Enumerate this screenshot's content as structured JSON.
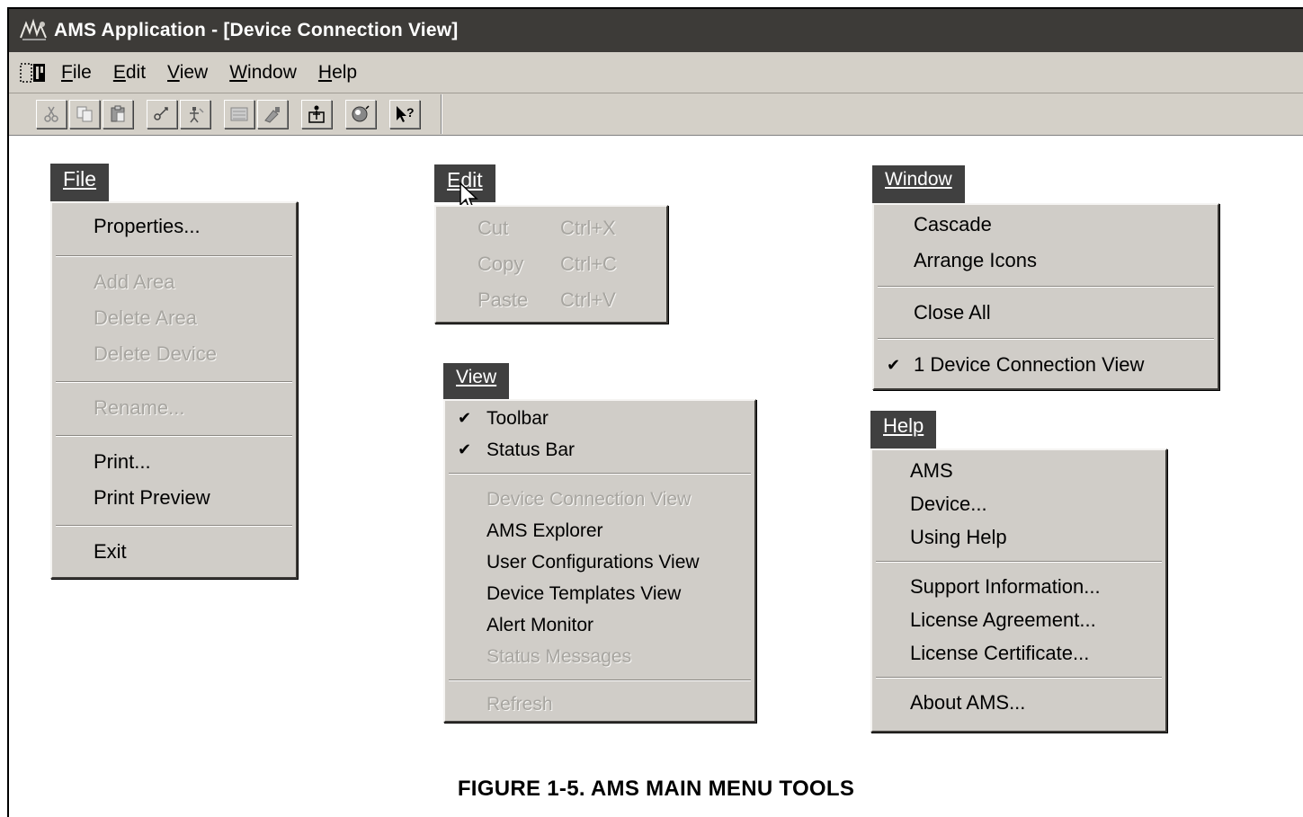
{
  "window": {
    "title": "AMS Application - [Device Connection View]",
    "titlebar_color": "#3d3b38",
    "chrome_color": "#d4d0c8"
  },
  "menubar": {
    "items": [
      "File",
      "Edit",
      "View",
      "Window",
      "Help"
    ]
  },
  "toolbar": {
    "buttons": [
      "cut-icon",
      "copy-icon",
      "paste-icon",
      "connect-icon",
      "disconnect-icon",
      "device-list-icon",
      "configure-icon",
      "properties-icon",
      "sound-icon",
      "context-help-icon"
    ]
  },
  "menus": {
    "file": {
      "header": "File",
      "items": [
        "Properties...",
        "Add Area",
        "Delete Area",
        "Delete Device",
        "Rename...",
        "Print...",
        "Print Preview",
        "Exit"
      ],
      "disabled": [
        "Add Area",
        "Delete Area",
        "Delete Device",
        "Rename..."
      ]
    },
    "edit": {
      "header": "Edit",
      "items": [
        {
          "label": "Cut",
          "shortcut": "Ctrl+X"
        },
        {
          "label": "Copy",
          "shortcut": "Ctrl+C"
        },
        {
          "label": "Paste",
          "shortcut": "Ctrl+V"
        }
      ],
      "disabled": [
        "Cut",
        "Copy",
        "Paste"
      ]
    },
    "view": {
      "header": "View",
      "items": [
        "Toolbar",
        "Status Bar",
        "Device Connection View",
        "AMS Explorer",
        "User Configurations View",
        "Device Templates View",
        "Alert Monitor",
        "Status Messages",
        "Refresh"
      ],
      "checked": [
        "Toolbar",
        "Status Bar"
      ],
      "disabled": [
        "Device Connection View",
        "Status Messages",
        "Refresh"
      ]
    },
    "window": {
      "header": "Window",
      "items": [
        "Cascade",
        "Arrange Icons",
        "Close All",
        "1 Device Connection View"
      ],
      "checked": [
        "1 Device Connection View"
      ]
    },
    "help": {
      "header": "Help",
      "items": [
        "AMS",
        "Device...",
        "Using Help",
        "Support Information...",
        "License Agreement...",
        "License Certificate...",
        "About AMS..."
      ]
    }
  },
  "caption": "FIGURE 1-5. AMS MAIN MENU TOOLS"
}
